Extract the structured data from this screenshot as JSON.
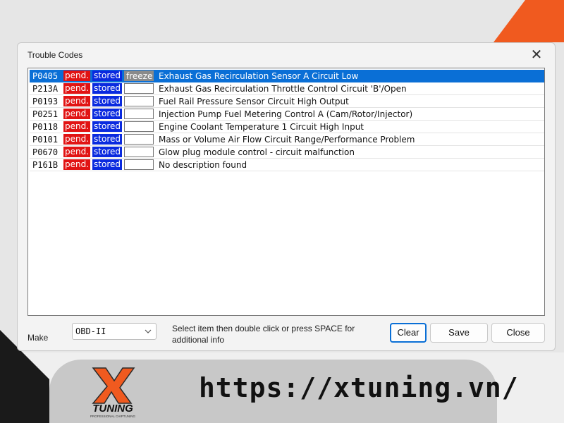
{
  "dialog": {
    "title": "Trouble Codes",
    "close_glyph": "✕"
  },
  "codes": [
    {
      "code": "P0405",
      "pend": "pend.",
      "stored": "stored",
      "freeze": "freeze",
      "description": "Exhaust Gas Recirculation Sensor A Circuit Low",
      "selected": true
    },
    {
      "code": "P213A",
      "pend": "pend.",
      "stored": "stored",
      "freeze": "",
      "description": "Exhaust Gas Recirculation Throttle Control Circuit 'B'/Open"
    },
    {
      "code": "P0193",
      "pend": "pend.",
      "stored": "stored",
      "freeze": "",
      "description": "Fuel Rail Pressure Sensor Circuit High Output"
    },
    {
      "code": "P0251",
      "pend": "pend.",
      "stored": "stored",
      "freeze": "",
      "description": "Injection Pump Fuel Metering Control A (Cam/Rotor/Injector)"
    },
    {
      "code": "P0118",
      "pend": "pend.",
      "stored": "stored",
      "freeze": "",
      "description": "Engine Coolant Temperature 1 Circuit High Input"
    },
    {
      "code": "P0101",
      "pend": "pend.",
      "stored": "stored",
      "freeze": "",
      "description": "Mass or Volume Air Flow Circuit Range/Performance Problem"
    },
    {
      "code": "P0670",
      "pend": "pend.",
      "stored": "stored",
      "freeze": "",
      "description": "Glow plug module control - circuit malfunction"
    },
    {
      "code": "P161B",
      "pend": "pend.",
      "stored": "stored",
      "freeze": "",
      "description": "No description found"
    }
  ],
  "footer": {
    "make_label": "Make",
    "make_value": "OBD-II",
    "hint": "Select item then double click or press SPACE for additional info",
    "clear_label": "Clear",
    "save_label": "Save",
    "close_label": "Close"
  },
  "brand": {
    "logo_text": "TUNING",
    "logo_tagline": "PROFESSIONAL CHIPTUNING",
    "url": "https://xtuning.vn/"
  },
  "colors": {
    "selection": "#0a6fd6",
    "pend": "#e11313",
    "stored": "#0a2adf",
    "accent_orange": "#f05a1f"
  },
  "icons": {
    "close": "close-icon",
    "dropdown": "chevron-down-icon"
  }
}
